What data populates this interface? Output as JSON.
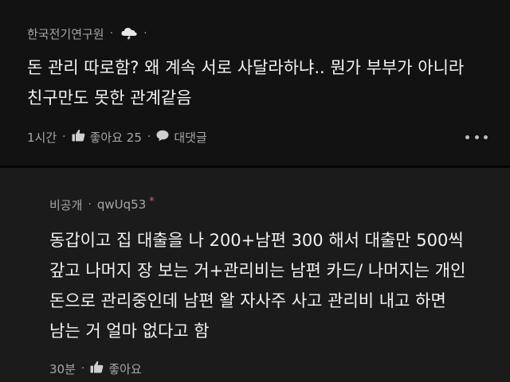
{
  "top_comment": {
    "author": "한국전기연구원",
    "author_icon": "cloud-lightning-icon",
    "body": "돈 관리 따로함? 왜 계속 서로 사달라하냐.. 뭔가 부부가 아니라\n친구만도 못한 관계같음",
    "time": "1시간",
    "like_label": "좋아요 25",
    "reply_label": "대댓글",
    "more_icon": "more-dots-icon"
  },
  "reply_comment": {
    "author": "비공개",
    "user_id": "qwUq53",
    "marker": "*",
    "body": "동갑이고 집 대출을 나 200+남편 300 해서 대출만 500씩\n갚고 나머지 장 보는 거+관리비는 남편 카드/ 나머지는 개인\n돈으로 관리중인데 남편 왈 자사주 사고 관리비 내고 하면\n남는 거 얼마 없다고 함",
    "time": "30분",
    "like_label": "좋아요"
  },
  "colors": {
    "background": "#0f0f10",
    "reply_background": "#1b1b1c",
    "text": "#f2f2f2",
    "meta_text": "#a7a7a7",
    "marker": "#e05a5a"
  }
}
